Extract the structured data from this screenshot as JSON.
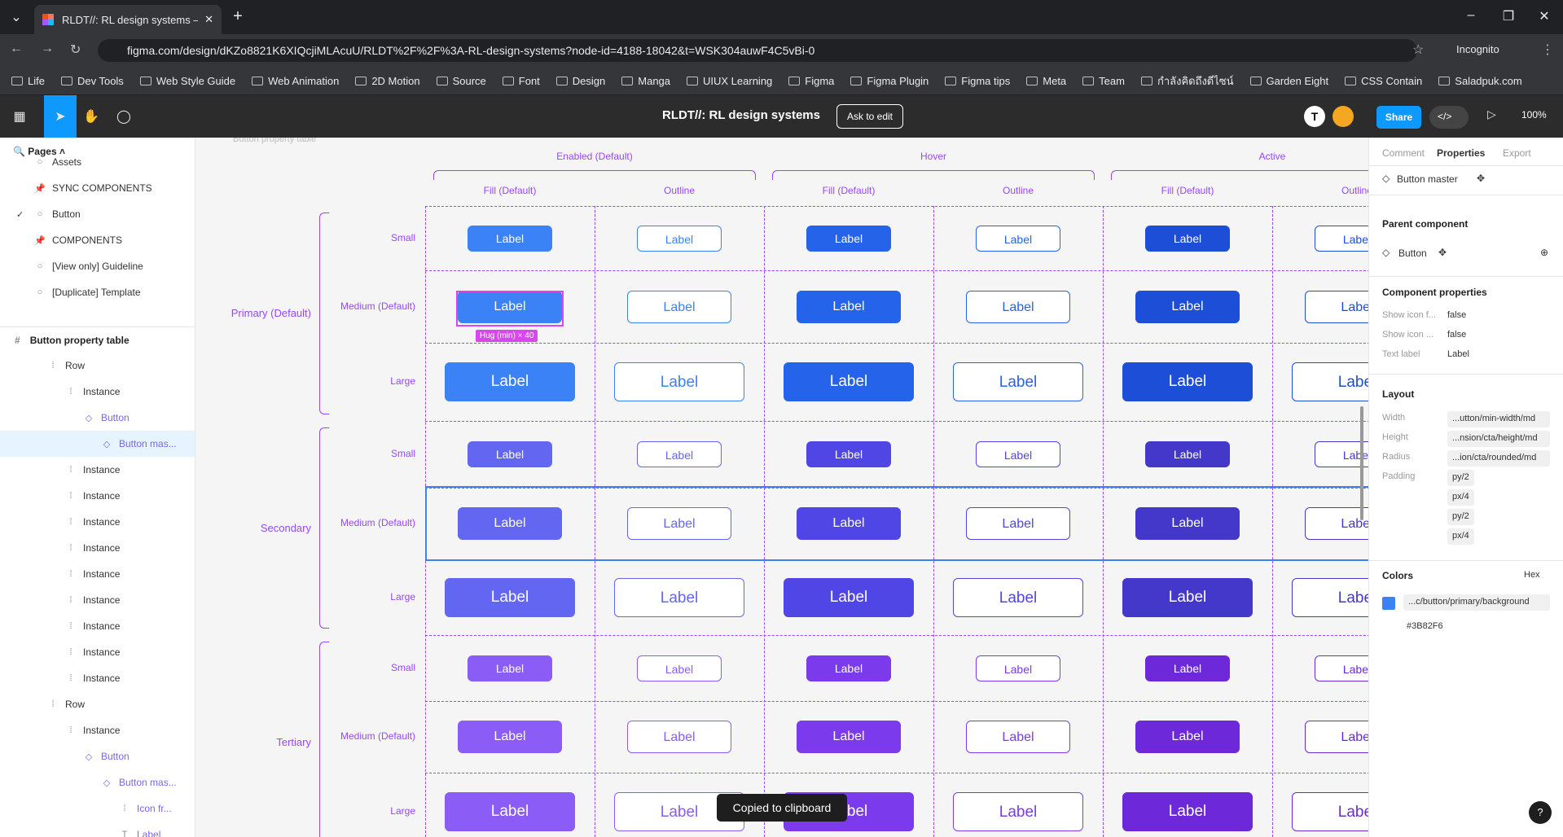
{
  "browser": {
    "tab_title": "RLDT//: RL design systems – Fig",
    "url": "figma.com/design/dKZo8821K6XIQcjiMLAcuU/RLDT%2F%2F%3A-RL-design-systems?node-id=4188-18042&t=WSK304auwF4C5vBi-0",
    "incognito": "Incognito",
    "bookmarks": [
      "Life",
      "Dev Tools",
      "Web Style Guide",
      "Web Animation",
      "2D Motion",
      "Source",
      "Font",
      "Design",
      "Manga",
      "UIUX Learning",
      "Figma",
      "Figma Plugin",
      "Figma tips",
      "Meta",
      "Team",
      "กำลังคิดถึงดีไซน์",
      "Garden Eight",
      "CSS Contain",
      "Saladpuk.com"
    ]
  },
  "figma": {
    "file_title": "RLDT//: RL design systems",
    "ask_to_edit": "Ask to edit",
    "share": "Share",
    "zoom": "100%",
    "avatar_letter": "T"
  },
  "left_panel": {
    "pages_label": "Pages",
    "pages": [
      {
        "label": "Assets",
        "icon": "circle"
      },
      {
        "label": "SYNC COMPONENTS",
        "icon": "pin"
      },
      {
        "label": "Button",
        "icon": "circle",
        "checked": true
      },
      {
        "label": "COMPONENTS",
        "icon": "pin"
      },
      {
        "label": "[View only] Guideline",
        "icon": "circle"
      },
      {
        "label": "[Duplicate] Template",
        "icon": "circle"
      }
    ],
    "frame": "Button property table",
    "layers": [
      {
        "label": "Row",
        "indent": 1,
        "type": "row"
      },
      {
        "label": "Instance",
        "indent": 2,
        "type": "instance"
      },
      {
        "label": "Button",
        "indent": 3,
        "type": "component"
      },
      {
        "label": "Button mas...",
        "indent": 4,
        "type": "component",
        "selected": true
      },
      {
        "label": "Instance",
        "indent": 2,
        "type": "instance"
      },
      {
        "label": "Instance",
        "indent": 2,
        "type": "instance"
      },
      {
        "label": "Instance",
        "indent": 2,
        "type": "instance"
      },
      {
        "label": "Instance",
        "indent": 2,
        "type": "instance"
      },
      {
        "label": "Instance",
        "indent": 2,
        "type": "instance"
      },
      {
        "label": "Instance",
        "indent": 2,
        "type": "instance"
      },
      {
        "label": "Instance",
        "indent": 2,
        "type": "instance"
      },
      {
        "label": "Instance",
        "indent": 2,
        "type": "instance"
      },
      {
        "label": "Instance",
        "indent": 2,
        "type": "instance"
      },
      {
        "label": "Row",
        "indent": 1,
        "type": "row"
      },
      {
        "label": "Instance",
        "indent": 2,
        "type": "instance"
      },
      {
        "label": "Button",
        "indent": 3,
        "type": "component"
      },
      {
        "label": "Button mas...",
        "indent": 4,
        "type": "component"
      },
      {
        "label": "Icon fr...",
        "indent": 5,
        "type": "frame"
      },
      {
        "label": "Label",
        "indent": 5,
        "type": "text"
      }
    ]
  },
  "canvas": {
    "frame_label": "Button property table",
    "states": [
      "Enabled (Default)",
      "Hover",
      "Active"
    ],
    "columns": [
      "Fill (Default)",
      "Outline",
      "Fill (Default)",
      "Outline",
      "Fill (Default)",
      "Outline"
    ],
    "groups": [
      "Primary (Default)",
      "Secondary",
      "Tertiary"
    ],
    "sizes": [
      "Small",
      "Medium (Default)",
      "Large"
    ],
    "button_label": "Label",
    "hug_tag": "Hug (min) × 40",
    "colors": {
      "primary": [
        "#3b82f6",
        "#2563eb",
        "#1d4ed8"
      ],
      "secondary": [
        "#6366f1",
        "#4f46e5",
        "#4338ca"
      ],
      "tertiary": [
        "#8b5cf6",
        "#7c3aed",
        "#6d28d9"
      ],
      "guide": "#9747ff"
    }
  },
  "right_panel": {
    "tabs": [
      "Comment",
      "Properties",
      "Export"
    ],
    "active_tab": "Properties",
    "component": "Button master",
    "parent_heading": "Parent component",
    "parent": "Button",
    "comp_props_heading": "Component properties",
    "props": [
      {
        "k": "Show icon f...",
        "v": "false"
      },
      {
        "k": "Show icon ...",
        "v": "false"
      },
      {
        "k": "Text label",
        "v": "Label"
      }
    ],
    "layout_heading": "Layout",
    "layout": [
      {
        "k": "Width",
        "v": "...utton/min-width/md"
      },
      {
        "k": "Height",
        "v": "...nsion/cta/height/md"
      },
      {
        "k": "Radius",
        "v": "...ion/cta/rounded/md"
      },
      {
        "k": "Padding",
        "v": "py/2"
      }
    ],
    "padding_extra": [
      "px/4",
      "py/2",
      "px/4"
    ],
    "colors_heading": "Colors",
    "color_format": "Hex",
    "color_token": "...c/button/primary/background",
    "color_hex": "#3B82F6"
  },
  "toast": "Copied to clipboard"
}
